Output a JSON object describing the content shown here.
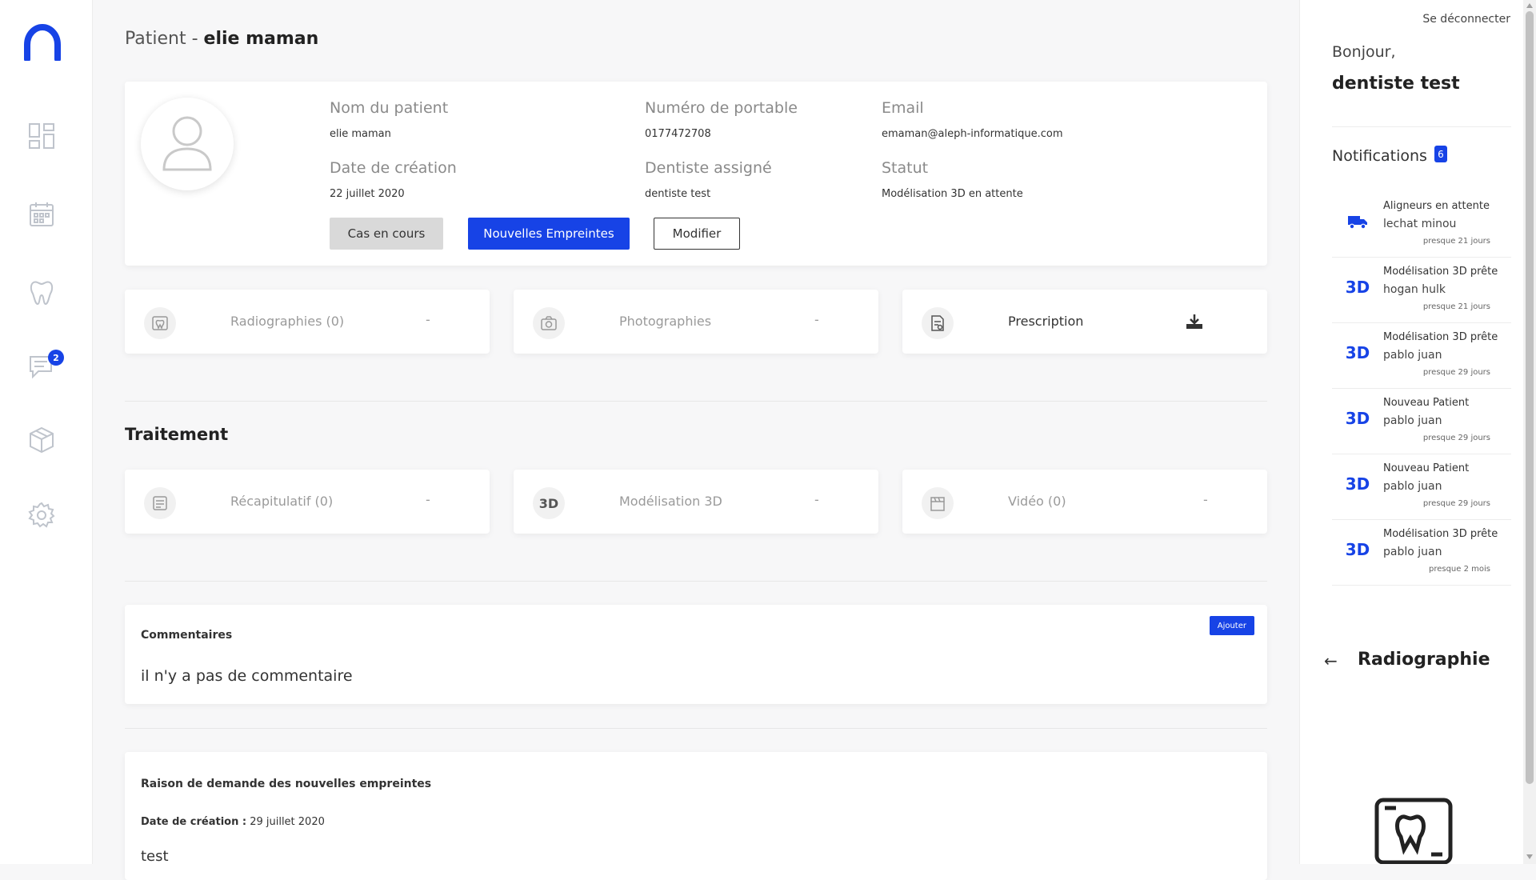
{
  "brand": {
    "accent": "#1743e6"
  },
  "sidebar": {
    "items": [
      {
        "icon": "dashboard-icon"
      },
      {
        "icon": "calendar-icon"
      },
      {
        "icon": "tooth-icon"
      },
      {
        "icon": "messages-icon",
        "badge": "2"
      },
      {
        "icon": "box-icon"
      },
      {
        "icon": "gear-icon"
      }
    ]
  },
  "page": {
    "title_prefix": "Patient - ",
    "patient_name": "elie maman"
  },
  "patient": {
    "fields": {
      "name_label": "Nom du patient",
      "name_value": "elie maman",
      "phone_label": "Numéro de portable",
      "phone_value": "0177472708",
      "email_label": "Email",
      "email_value": "emaman@aleph-informatique.com",
      "created_label": "Date de création",
      "created_value": "22 juillet 2020",
      "dentist_label": "Dentiste assigné",
      "dentist_value": "dentiste test",
      "status_label": "Statut",
      "status_value": "Modélisation 3D en attente"
    },
    "actions": {
      "cases": "Cas en cours",
      "new_impressions": "Nouvelles Empreintes",
      "edit": "Modifier"
    }
  },
  "documents": [
    {
      "label": "Radiographies (0)",
      "dash": "-"
    },
    {
      "label": "Photographies",
      "dash": "-"
    },
    {
      "label": "Prescription"
    }
  ],
  "treatment": {
    "title": "Traitement",
    "items": [
      {
        "label": "Récapitulatif (0)",
        "dash": "-"
      },
      {
        "label": "Modélisation 3D",
        "dash": "-",
        "icon_text": "3D"
      },
      {
        "label": "Vidéo (0)",
        "dash": "-"
      }
    ]
  },
  "comments": {
    "title": "Commentaires",
    "add_label": "Ajouter",
    "empty": "il n'y a pas de commentaire"
  },
  "reason": {
    "title": "Raison de demande des nouvelles empreintes",
    "date_label": "Date de création :",
    "date_value": " 29 juillet 2020",
    "text": "test"
  },
  "right_panel": {
    "logout": "Se déconnecter",
    "greeting": "Bonjour,",
    "user": "dentiste test",
    "notifications_title": "Notifications",
    "notifications_count": "6",
    "notifications": [
      {
        "icon": "truck-icon",
        "title": "Aligneurs en attente",
        "subtitle": "lechat minou",
        "time": "presque 21 jours"
      },
      {
        "icon_text": "3D",
        "title": "Modélisation 3D prête",
        "subtitle": "hogan hulk",
        "time": "presque 21 jours"
      },
      {
        "icon_text": "3D",
        "title": "Modélisation 3D prête",
        "subtitle": "pablo juan",
        "time": "presque 29 jours"
      },
      {
        "icon_text": "3D",
        "title": "Nouveau Patient",
        "subtitle": "pablo juan",
        "time": "presque 29 jours"
      },
      {
        "icon_text": "3D",
        "title": "Nouveau Patient",
        "subtitle": "pablo juan",
        "time": "presque 29 jours"
      },
      {
        "icon_text": "3D",
        "title": "Modélisation 3D prête",
        "subtitle": "pablo juan",
        "time": "presque 2 mois"
      }
    ],
    "back_arrow": "←",
    "section_title": "Radiographie"
  }
}
